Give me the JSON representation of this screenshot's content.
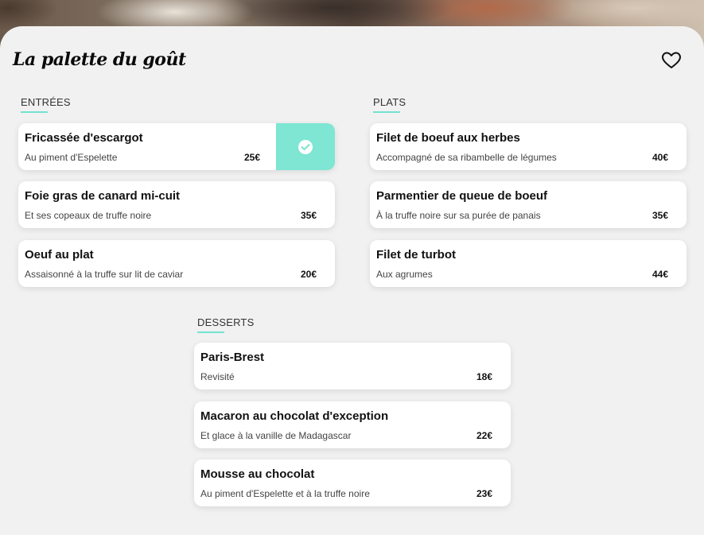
{
  "app": {
    "title": "La palette du goût"
  },
  "header": {
    "favorite_icon": "heart-outline-icon"
  },
  "colors": {
    "accent": "#7ee6d2",
    "underline": "#73e3cf",
    "background": "#f1f1f1"
  },
  "sections": {
    "entrees": {
      "label": "ENTRÉES",
      "items": [
        {
          "name": "Fricassée d'escargot",
          "desc": "Au piment d'Espelette",
          "price": "25€",
          "selected": true
        },
        {
          "name": "Foie gras de canard mi-cuit",
          "desc": "Et ses copeaux de truffe noire",
          "price": "35€",
          "selected": false
        },
        {
          "name": "Oeuf au plat",
          "desc": "Assaisonné à la truffe sur lit de caviar",
          "price": "20€",
          "selected": false
        }
      ]
    },
    "plats": {
      "label": "PLATS",
      "items": [
        {
          "name": "Filet de boeuf aux herbes",
          "desc": "Accompagné de sa ribambelle de légumes",
          "price": "40€",
          "selected": false
        },
        {
          "name": "Parmentier de queue de boeuf",
          "desc": "À la truffe noire sur sa purée de panais",
          "price": "35€",
          "selected": false
        },
        {
          "name": "Filet de turbot",
          "desc": "Aux agrumes",
          "price": "44€",
          "selected": false
        }
      ]
    },
    "desserts": {
      "label": "DESSERTS",
      "items": [
        {
          "name": "Paris-Brest",
          "desc": "Revisité",
          "price": "18€",
          "selected": false
        },
        {
          "name": "Macaron au chocolat d'exception",
          "desc": "Et glace à la vanille de Madagascar",
          "price": "22€",
          "selected": false
        },
        {
          "name": "Mousse au chocolat",
          "desc": "Au piment d'Espelette et à la truffe noire",
          "price": "23€",
          "selected": false
        }
      ]
    }
  }
}
